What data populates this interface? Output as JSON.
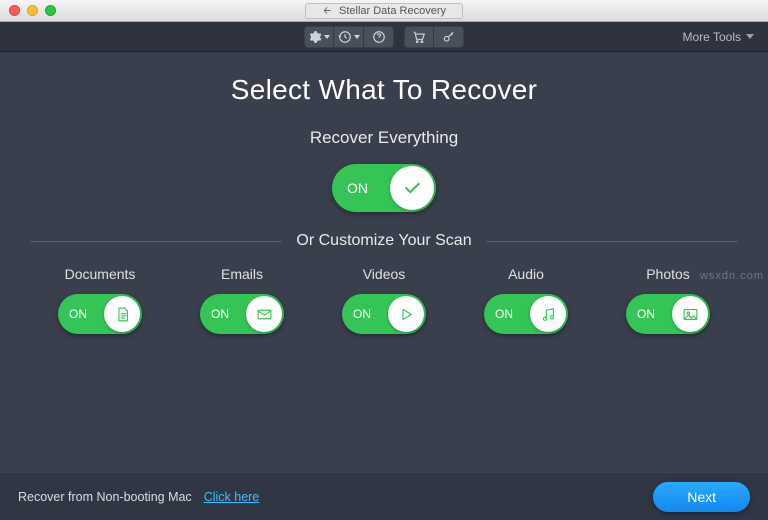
{
  "window": {
    "title": "Stellar Data Recovery"
  },
  "toolbar": {
    "more_tools": "More Tools"
  },
  "main": {
    "heading": "Select What To Recover",
    "recover_all_label": "Recover Everything",
    "customize_label": "Or Customize Your Scan",
    "on_text": "ON"
  },
  "categories": [
    {
      "label": "Documents",
      "icon": "document-icon",
      "on": "ON"
    },
    {
      "label": "Emails",
      "icon": "mail-icon",
      "on": "ON"
    },
    {
      "label": "Videos",
      "icon": "play-icon",
      "on": "ON"
    },
    {
      "label": "Audio",
      "icon": "music-icon",
      "on": "ON"
    },
    {
      "label": "Photos",
      "icon": "image-icon",
      "on": "ON"
    }
  ],
  "footer": {
    "nonboot_text": "Recover from Non-booting Mac",
    "link_text": "Click here",
    "next": "Next"
  }
}
